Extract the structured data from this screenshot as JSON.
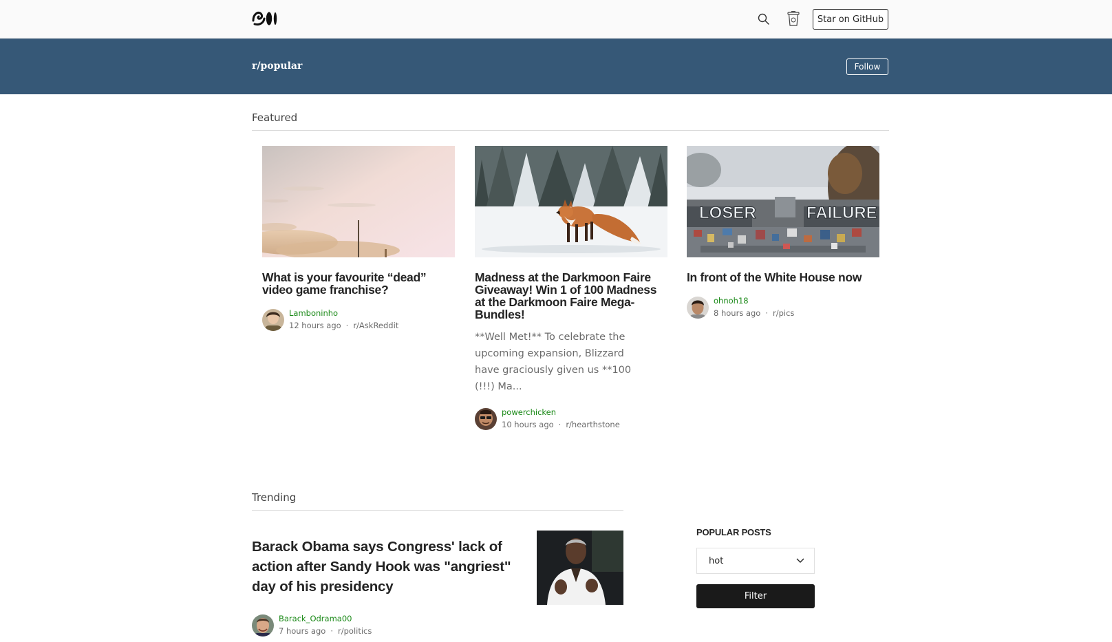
{
  "nav": {
    "logo": "medium-logo",
    "github_label": "Star on GitHub",
    "icons": [
      "search-icon",
      "coffee-cup-icon"
    ]
  },
  "banner": {
    "title": "r/popular",
    "follow_label": "Follow",
    "color": "#365877"
  },
  "featured": {
    "heading": "Featured",
    "cards": [
      {
        "title": "What is your favourite “dead” video game franchise?",
        "excerpt": "",
        "author": "Lamboninho",
        "time": "12 hours ago",
        "subreddit": "r/AskReddit"
      },
      {
        "title": "Madness at the Darkmoon Faire Giveaway! Win 1 of 100 Madness at the Darkmoon Faire Mega-Bundles!",
        "excerpt": "**Well Met!** To celebrate the upcoming expansion, Blizzard have graciously given us **100 (!!!) Ma...",
        "author": "powerchicken",
        "time": "10 hours ago",
        "subreddit": "r/hearthstone"
      },
      {
        "title": "In front of the White House now",
        "excerpt": "",
        "author": "ohnoh18",
        "time": "8 hours ago",
        "subreddit": "r/pics",
        "image_text": [
          "LOSER",
          "FAILURE"
        ]
      }
    ]
  },
  "trending": {
    "heading": "Trending",
    "post": {
      "title": "Barack Obama says Congress' lack of action after Sandy Hook was \"angriest\" day of his presidency",
      "author": "Barack_Odrama00",
      "time": "7 hours ago",
      "subreddit": "r/politics"
    }
  },
  "sidebar": {
    "heading": "POPULAR POSTS",
    "sort_value": "hot",
    "filter_label": "Filter"
  },
  "colors": {
    "author_green": "#1a8917",
    "muted": "#6b6b6b",
    "text": "#242424",
    "button_dark": "#1a1a1a"
  }
}
